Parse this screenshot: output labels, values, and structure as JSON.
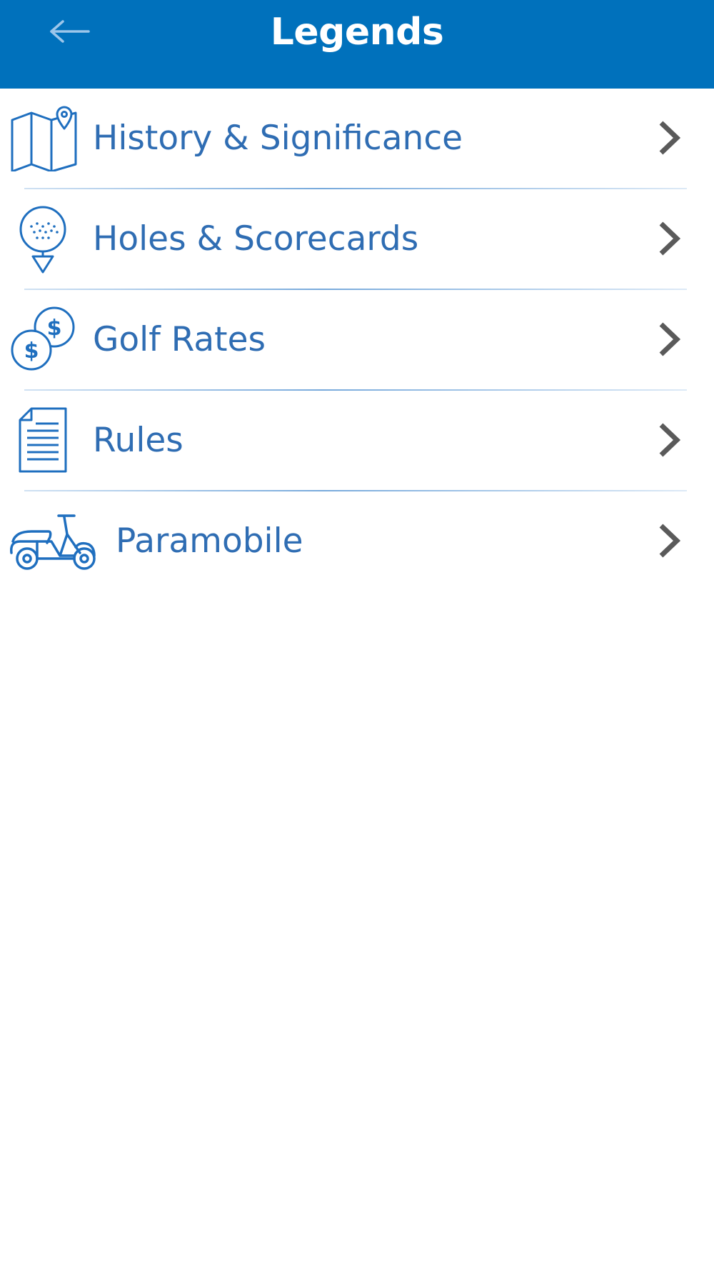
{
  "header": {
    "title": "Legends",
    "back_icon": "arrow-left-icon"
  },
  "colors": {
    "header_bg": "#0071bc",
    "accent": "#2f6db3",
    "chevron": "#5a5a5a"
  },
  "menu": {
    "items": [
      {
        "label": "History & Significance",
        "icon": "map-pin-icon"
      },
      {
        "label": "Holes & Scorecards",
        "icon": "golf-ball-tee-icon"
      },
      {
        "label": "Golf Rates",
        "icon": "dollar-coins-icon"
      },
      {
        "label": "Rules",
        "icon": "document-icon"
      },
      {
        "label": "Paramobile",
        "icon": "scooter-icon"
      }
    ]
  }
}
